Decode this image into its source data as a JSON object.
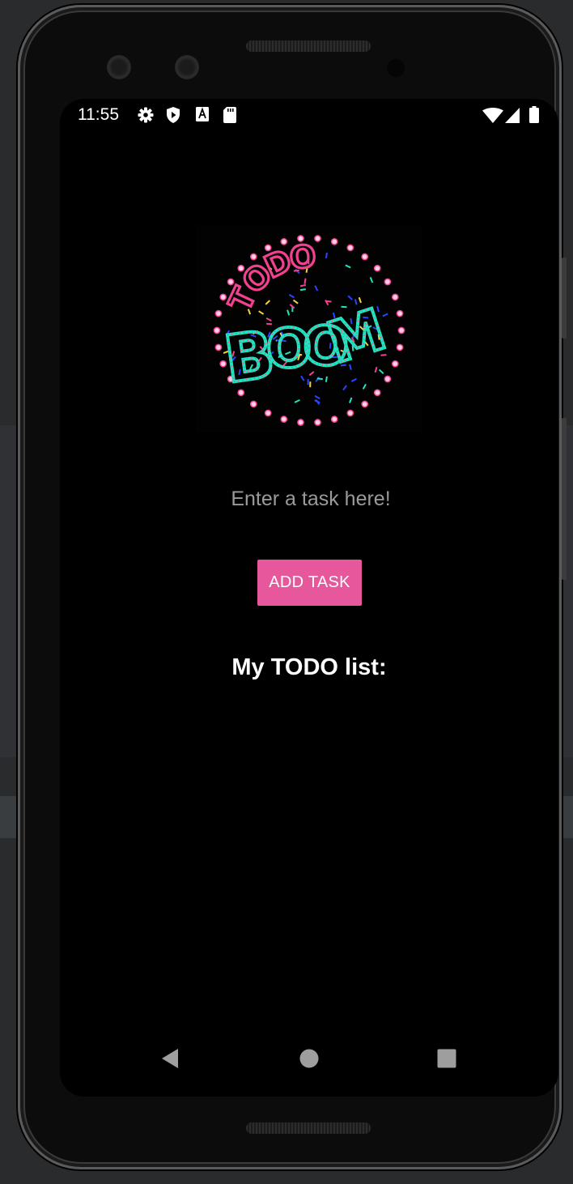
{
  "status_bar": {
    "time": "11:55",
    "left_icons": [
      "gear-icon",
      "shield-play-icon",
      "a-font-icon",
      "sd-card-icon"
    ],
    "right_icons": [
      "wifi-icon",
      "cellular-signal-icon",
      "battery-icon"
    ]
  },
  "logo": {
    "text": "TODO BOOM",
    "colors": {
      "pink": "#f2428f",
      "teal": "#1ee6c0",
      "blue": "#2a44ff",
      "yellow": "#f2d33a"
    }
  },
  "task_input": {
    "placeholder": "Enter a task here!",
    "value": ""
  },
  "add_button": {
    "label": "ADD TASK",
    "color": "#e6579b"
  },
  "list": {
    "title": "My TODO list:",
    "items": []
  },
  "nav_bar": {
    "buttons": [
      "back-icon",
      "home-icon",
      "recents-icon"
    ]
  }
}
